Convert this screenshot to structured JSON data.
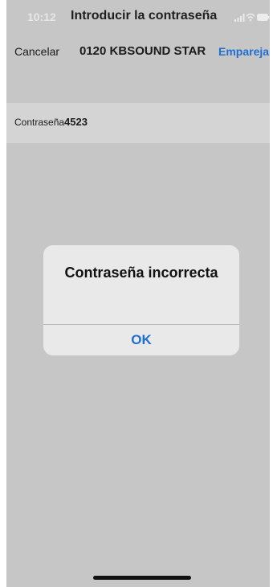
{
  "status_bar": {
    "time": "10:12",
    "title": "Introducir la contraseña",
    "icons": [
      "signal-icon",
      "wifi-icon",
      "battery-icon"
    ]
  },
  "nav": {
    "cancel_label": "Cancelar",
    "title": "0120 KBSOUND STAR",
    "pair_label": "Emparejar"
  },
  "password_row": {
    "label": "Contraseña",
    "value": "4523"
  },
  "alert": {
    "title": "Contraseña incorrecta",
    "ok_label": "OK"
  },
  "colors": {
    "background": "#c6c6c6",
    "accent": "#1f6fd1",
    "alert_background": "#e9e9e9"
  }
}
